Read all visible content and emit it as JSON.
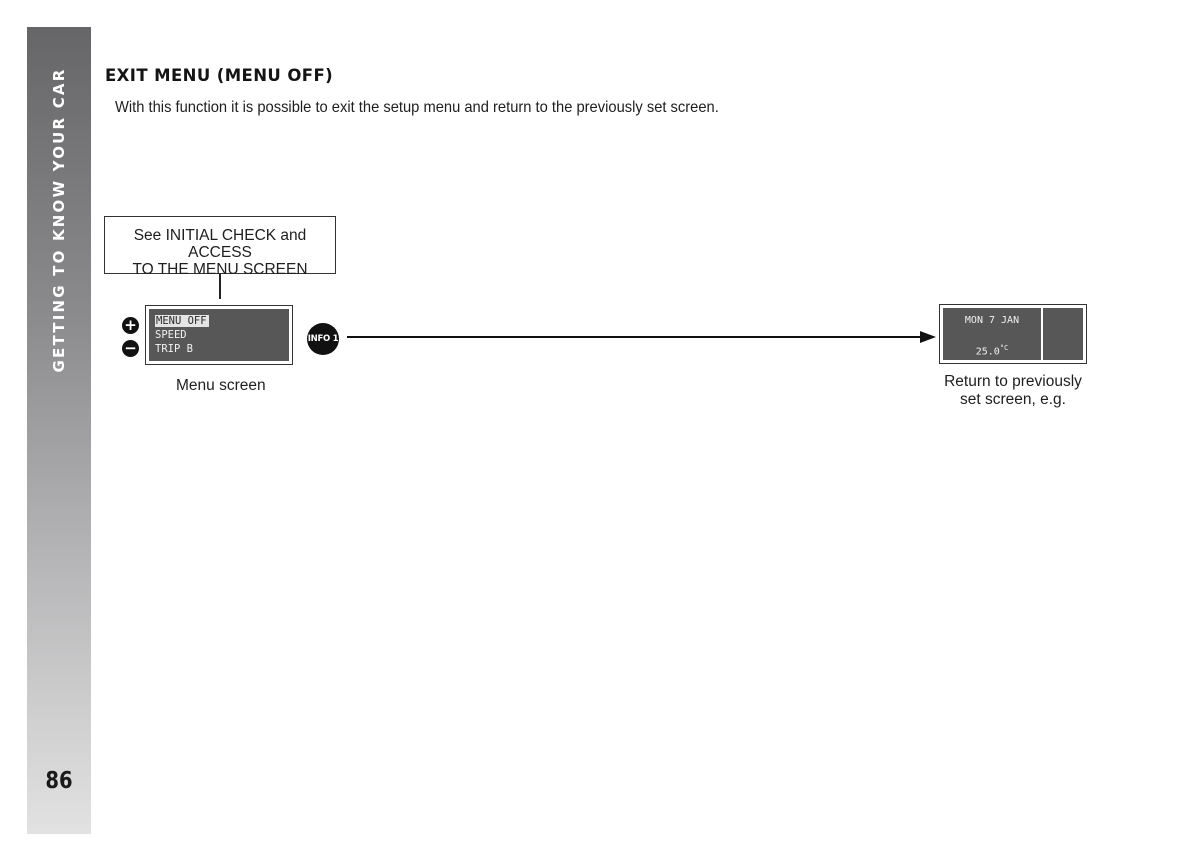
{
  "sidebar": {
    "section_label": "GETTING TO KNOW YOUR CAR",
    "page_number": "86"
  },
  "content": {
    "title": "EXIT MENU (MENU OFF)",
    "intro": "With this function it is possible to exit the setup menu and return to the previously set screen."
  },
  "diagram": {
    "reference_box": {
      "line1": "See INITIAL CHECK and ACCESS",
      "line2": "TO THE MENU SCREEN"
    },
    "menu_screen": {
      "items": [
        {
          "label": "MENU OFF",
          "selected": true
        },
        {
          "label": "SPEED",
          "selected": false
        },
        {
          "label": "TRIP B",
          "selected": false
        }
      ],
      "caption": "Menu screen"
    },
    "buttons": {
      "plus": "+",
      "minus": "−",
      "info": "INFO 1"
    },
    "result_screen": {
      "date": "MON 7 JAN",
      "temperature": "25.0",
      "temperature_unit": "°C",
      "caption_line1": "Return to previously",
      "caption_line2": "set screen, e.g."
    }
  }
}
